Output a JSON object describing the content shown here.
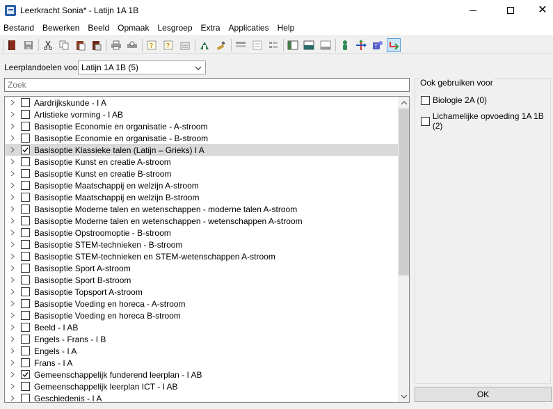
{
  "window": {
    "title": "Leerkracht Sonia* - Latijn 1A 1B",
    "minimize_glyph": "",
    "close_glyph": "✕"
  },
  "menu": [
    "Bestand",
    "Bewerken",
    "Beeld",
    "Opmaak",
    "Lesgroep",
    "Extra",
    "Applicaties",
    "Help"
  ],
  "toolbar": {
    "icons": [
      "book-icon",
      "save-icon",
      "cut-icon",
      "copy-icon",
      "paste-icon",
      "paste-special-icon",
      "print-icon",
      "print-preview-icon",
      "help-icon",
      "help-context-icon",
      "properties-icon",
      "import-icon",
      "brush-icon",
      "list-icon",
      "list-outline-icon",
      "list-indent-icon",
      "layout-icon",
      "layout-split-icon",
      "layout-bottom-icon",
      "person-icon",
      "move-icon",
      "teams-icon",
      "link-icon"
    ]
  },
  "filter": {
    "label": "Leerplandoelen voor",
    "selected": "Latijn 1A 1B (5)",
    "search_placeholder": "Zoek"
  },
  "tree": {
    "items": [
      {
        "label": "Aardrijkskunde - I A",
        "checked": false
      },
      {
        "label": "Artistieke vorming - I AB",
        "checked": false
      },
      {
        "label": "Basisoptie Economie en organisatie - A-stroom",
        "checked": false
      },
      {
        "label": "Basisoptie Economie en organisatie - B-stroom",
        "checked": false
      },
      {
        "label": "Basisoptie Klassieke talen (Latijn – Grieks) I A",
        "checked": true,
        "selected": true
      },
      {
        "label": "Basisoptie Kunst en creatie A-stroom",
        "checked": false
      },
      {
        "label": "Basisoptie Kunst en creatie B-stroom",
        "checked": false
      },
      {
        "label": "Basisoptie Maatschappij en welzijn A-stroom",
        "checked": false
      },
      {
        "label": "Basisoptie Maatschappij en welzijn B-stroom",
        "checked": false
      },
      {
        "label": "Basisoptie Moderne talen en wetenschappen - moderne talen A-stroom",
        "checked": false
      },
      {
        "label": "Basisoptie Moderne talen en wetenschappen - wetenschappen A-stroom",
        "checked": false
      },
      {
        "label": "Basisoptie Opstroomoptie - B-stroom",
        "checked": false
      },
      {
        "label": "Basisoptie STEM-technieken - B-stroom",
        "checked": false
      },
      {
        "label": "Basisoptie STEM-technieken en STEM-wetenschappen A-stroom",
        "checked": false
      },
      {
        "label": "Basisoptie Sport A-stroom",
        "checked": false
      },
      {
        "label": "Basisoptie Sport B-stroom",
        "checked": false
      },
      {
        "label": "Basisoptie Topsport A-stroom",
        "checked": false
      },
      {
        "label": "Basisoptie Voeding en horeca - A-stroom",
        "checked": false
      },
      {
        "label": "Basisoptie Voeding en horeca B-stroom",
        "checked": false
      },
      {
        "label": "Beeld - I AB",
        "checked": false
      },
      {
        "label": "Engels - Frans - I B",
        "checked": false
      },
      {
        "label": "Engels - I A",
        "checked": false
      },
      {
        "label": "Frans - I A",
        "checked": false
      },
      {
        "label": "Gemeenschappelijk funderend leerplan - I AB",
        "checked": true
      },
      {
        "label": "Gemeenschappelijk leerplan ICT - I AB",
        "checked": false
      },
      {
        "label": "Geschiedenis - I A",
        "checked": false
      }
    ]
  },
  "also_use": {
    "title": "Ook gebruiken voor",
    "items": [
      {
        "label": "Biologie 2A (0)",
        "checked": false
      },
      {
        "label": "Lichamelijke opvoeding 1A 1B (2)",
        "checked": false
      }
    ]
  },
  "ok_label": "OK",
  "colors": {
    "selected_row": "#d9d9d9",
    "accent": "#0078d7"
  }
}
